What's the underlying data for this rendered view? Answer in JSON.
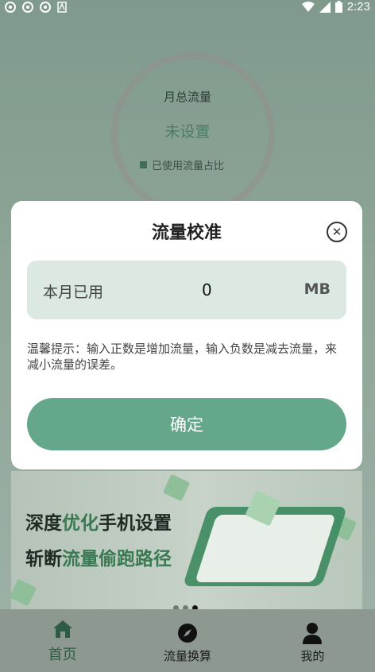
{
  "status_bar": {
    "time": "2:23"
  },
  "usage_ring": {
    "label": "月总流量",
    "status": "未设置",
    "legend": "已使用流量占比"
  },
  "dialog": {
    "title": "流量校准",
    "field_label": "本月已用",
    "field_value": "0",
    "field_unit": "MB",
    "hint": "温馨提示：输入正数是增加流量，输入负数是减去流量，来减小流量的误差。",
    "confirm_label": "确定"
  },
  "banner": {
    "line1_a": "深度",
    "line1_b": "优化",
    "line1_c": "手机设置",
    "line2_a": "斩断",
    "line2_b": "流量偷跑路径",
    "page_count": 3,
    "active_page": 3
  },
  "bottom_nav": [
    {
      "label": "首页",
      "icon": "home-icon",
      "active": true
    },
    {
      "label": "流量换算",
      "icon": "compass-icon",
      "active": false
    },
    {
      "label": "我的",
      "icon": "person-icon",
      "active": false
    }
  ],
  "colors": {
    "accent": "#64a78b",
    "field_bg": "#dce9e3",
    "dark_green": "#2e5b46"
  }
}
